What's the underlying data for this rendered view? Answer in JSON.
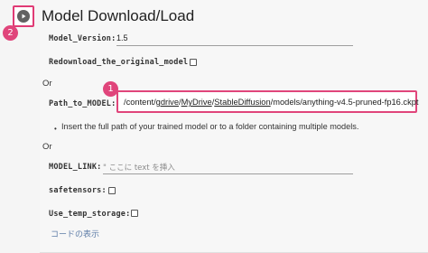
{
  "cell": {
    "title": "Model Download/Load",
    "run_badge": "2",
    "path_badge": "1",
    "show_code": "コードの表示"
  },
  "params": {
    "model_version": {
      "label": "Model_Version:",
      "value": "1.5"
    },
    "redownload": {
      "label": "Redownload_the_original_model:",
      "checked": false
    },
    "or_1": "Or",
    "path_to_model": {
      "label": "Path_to_MODEL:",
      "value_parts": [
        "/content/",
        "gdrive",
        "/",
        "MyDrive",
        "/",
        "StableDiffusion",
        "/models/anything-v4.5-pruned-fp16.ckpt"
      ],
      "hint": "Insert the full path of your trained model or to a folder containing multiple models."
    },
    "or_2": "Or",
    "model_link": {
      "label": "MODEL_LINK:",
      "placeholder": "\" ここに text を挿入"
    },
    "safetensors": {
      "label": "safetensors:",
      "checked": false
    },
    "use_temp_storage": {
      "label": "Use_temp_storage:",
      "checked": false
    }
  },
  "colors": {
    "highlight": "#e0457b",
    "link": "#5f7ea8"
  }
}
